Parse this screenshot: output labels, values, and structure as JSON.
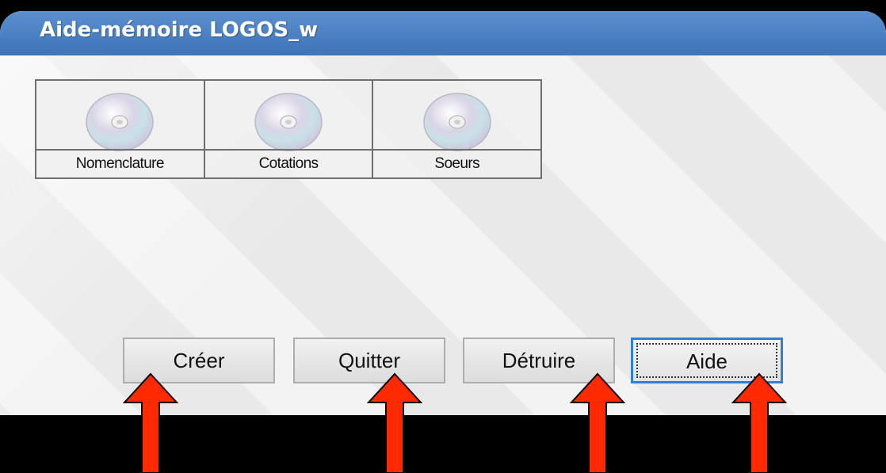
{
  "window": {
    "title": "Aide-mémoire LOGOS_w",
    "accent": "#4a80c4"
  },
  "toolbar": {
    "items": [
      {
        "label": "Nomenclature",
        "icon": "cd-disc-icon"
      },
      {
        "label": "Cotations",
        "icon": "cd-disc-icon"
      },
      {
        "label": "Soeurs",
        "icon": "cd-disc-icon"
      }
    ]
  },
  "buttons": {
    "create": "Créer",
    "quit": "Quitter",
    "destroy": "Détruire",
    "help": "Aide"
  },
  "annotations": {
    "arrow_color": "#ff2a00"
  }
}
